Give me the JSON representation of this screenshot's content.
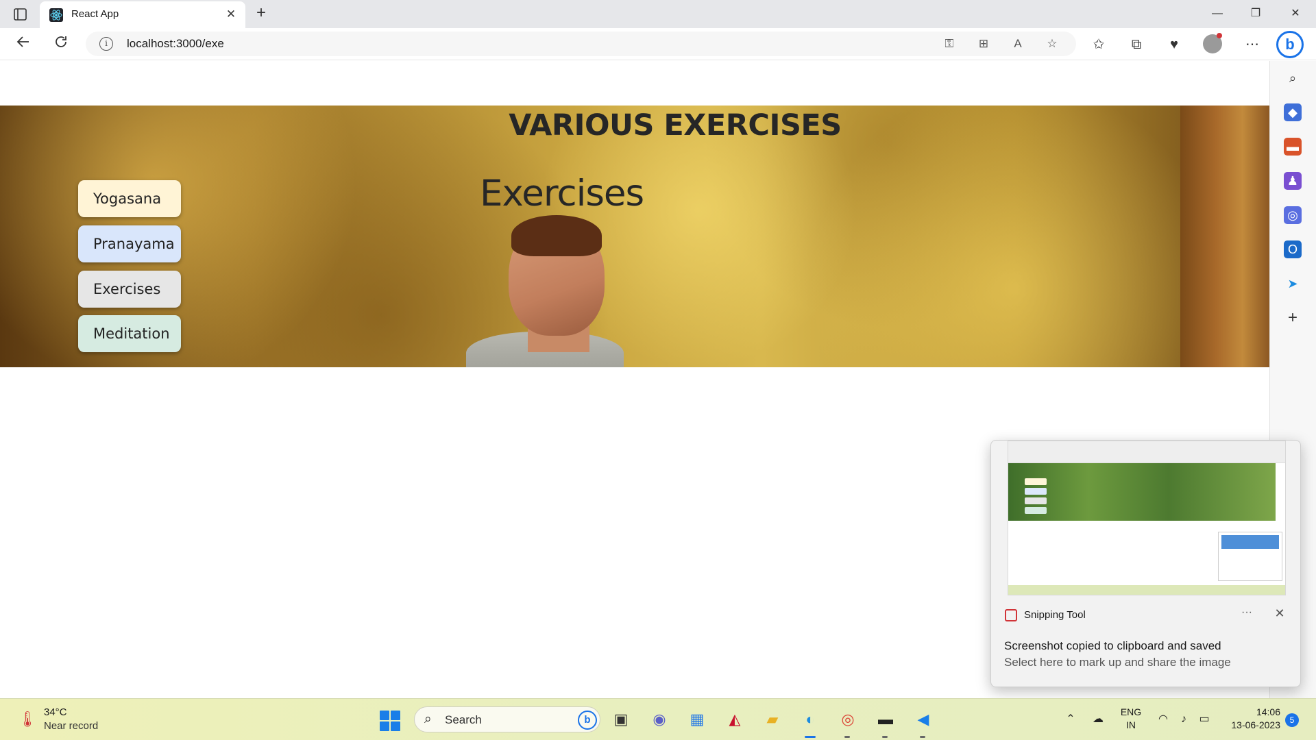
{
  "browser": {
    "tab_title": "React App",
    "tab_close": "✕",
    "new_tab": "+",
    "url": "localhost:3000/exe",
    "window_minimize": "—",
    "window_restore": "❐",
    "window_close": "✕"
  },
  "page": {
    "main_title": "VARIOUS EXERCISES",
    "sub_title": "Exercises",
    "nav": [
      {
        "label": "Yogasana",
        "color": "#fff4d6"
      },
      {
        "label": "Pranayama",
        "color": "#d9e6fb"
      },
      {
        "label": "Exercises",
        "color": "#e6e6e6"
      },
      {
        "label": "Meditation",
        "color": "#d6ebe1"
      }
    ]
  },
  "notification": {
    "app_name": "Snipping Tool",
    "more": "···",
    "close": "✕",
    "heading": "Screenshot copied to clipboard and saved",
    "subtext": "Select here to mark up and share the image"
  },
  "taskbar": {
    "weather_temp": "34°C",
    "weather_desc": "Near record",
    "search_placeholder": "Search",
    "lang_top": "ENG",
    "lang_bottom": "IN",
    "time": "14:06",
    "date": "13-06-2023",
    "notification_count": "5"
  },
  "colors": {
    "accent": "#1a73e8",
    "taskbar": "#e8efbf"
  }
}
